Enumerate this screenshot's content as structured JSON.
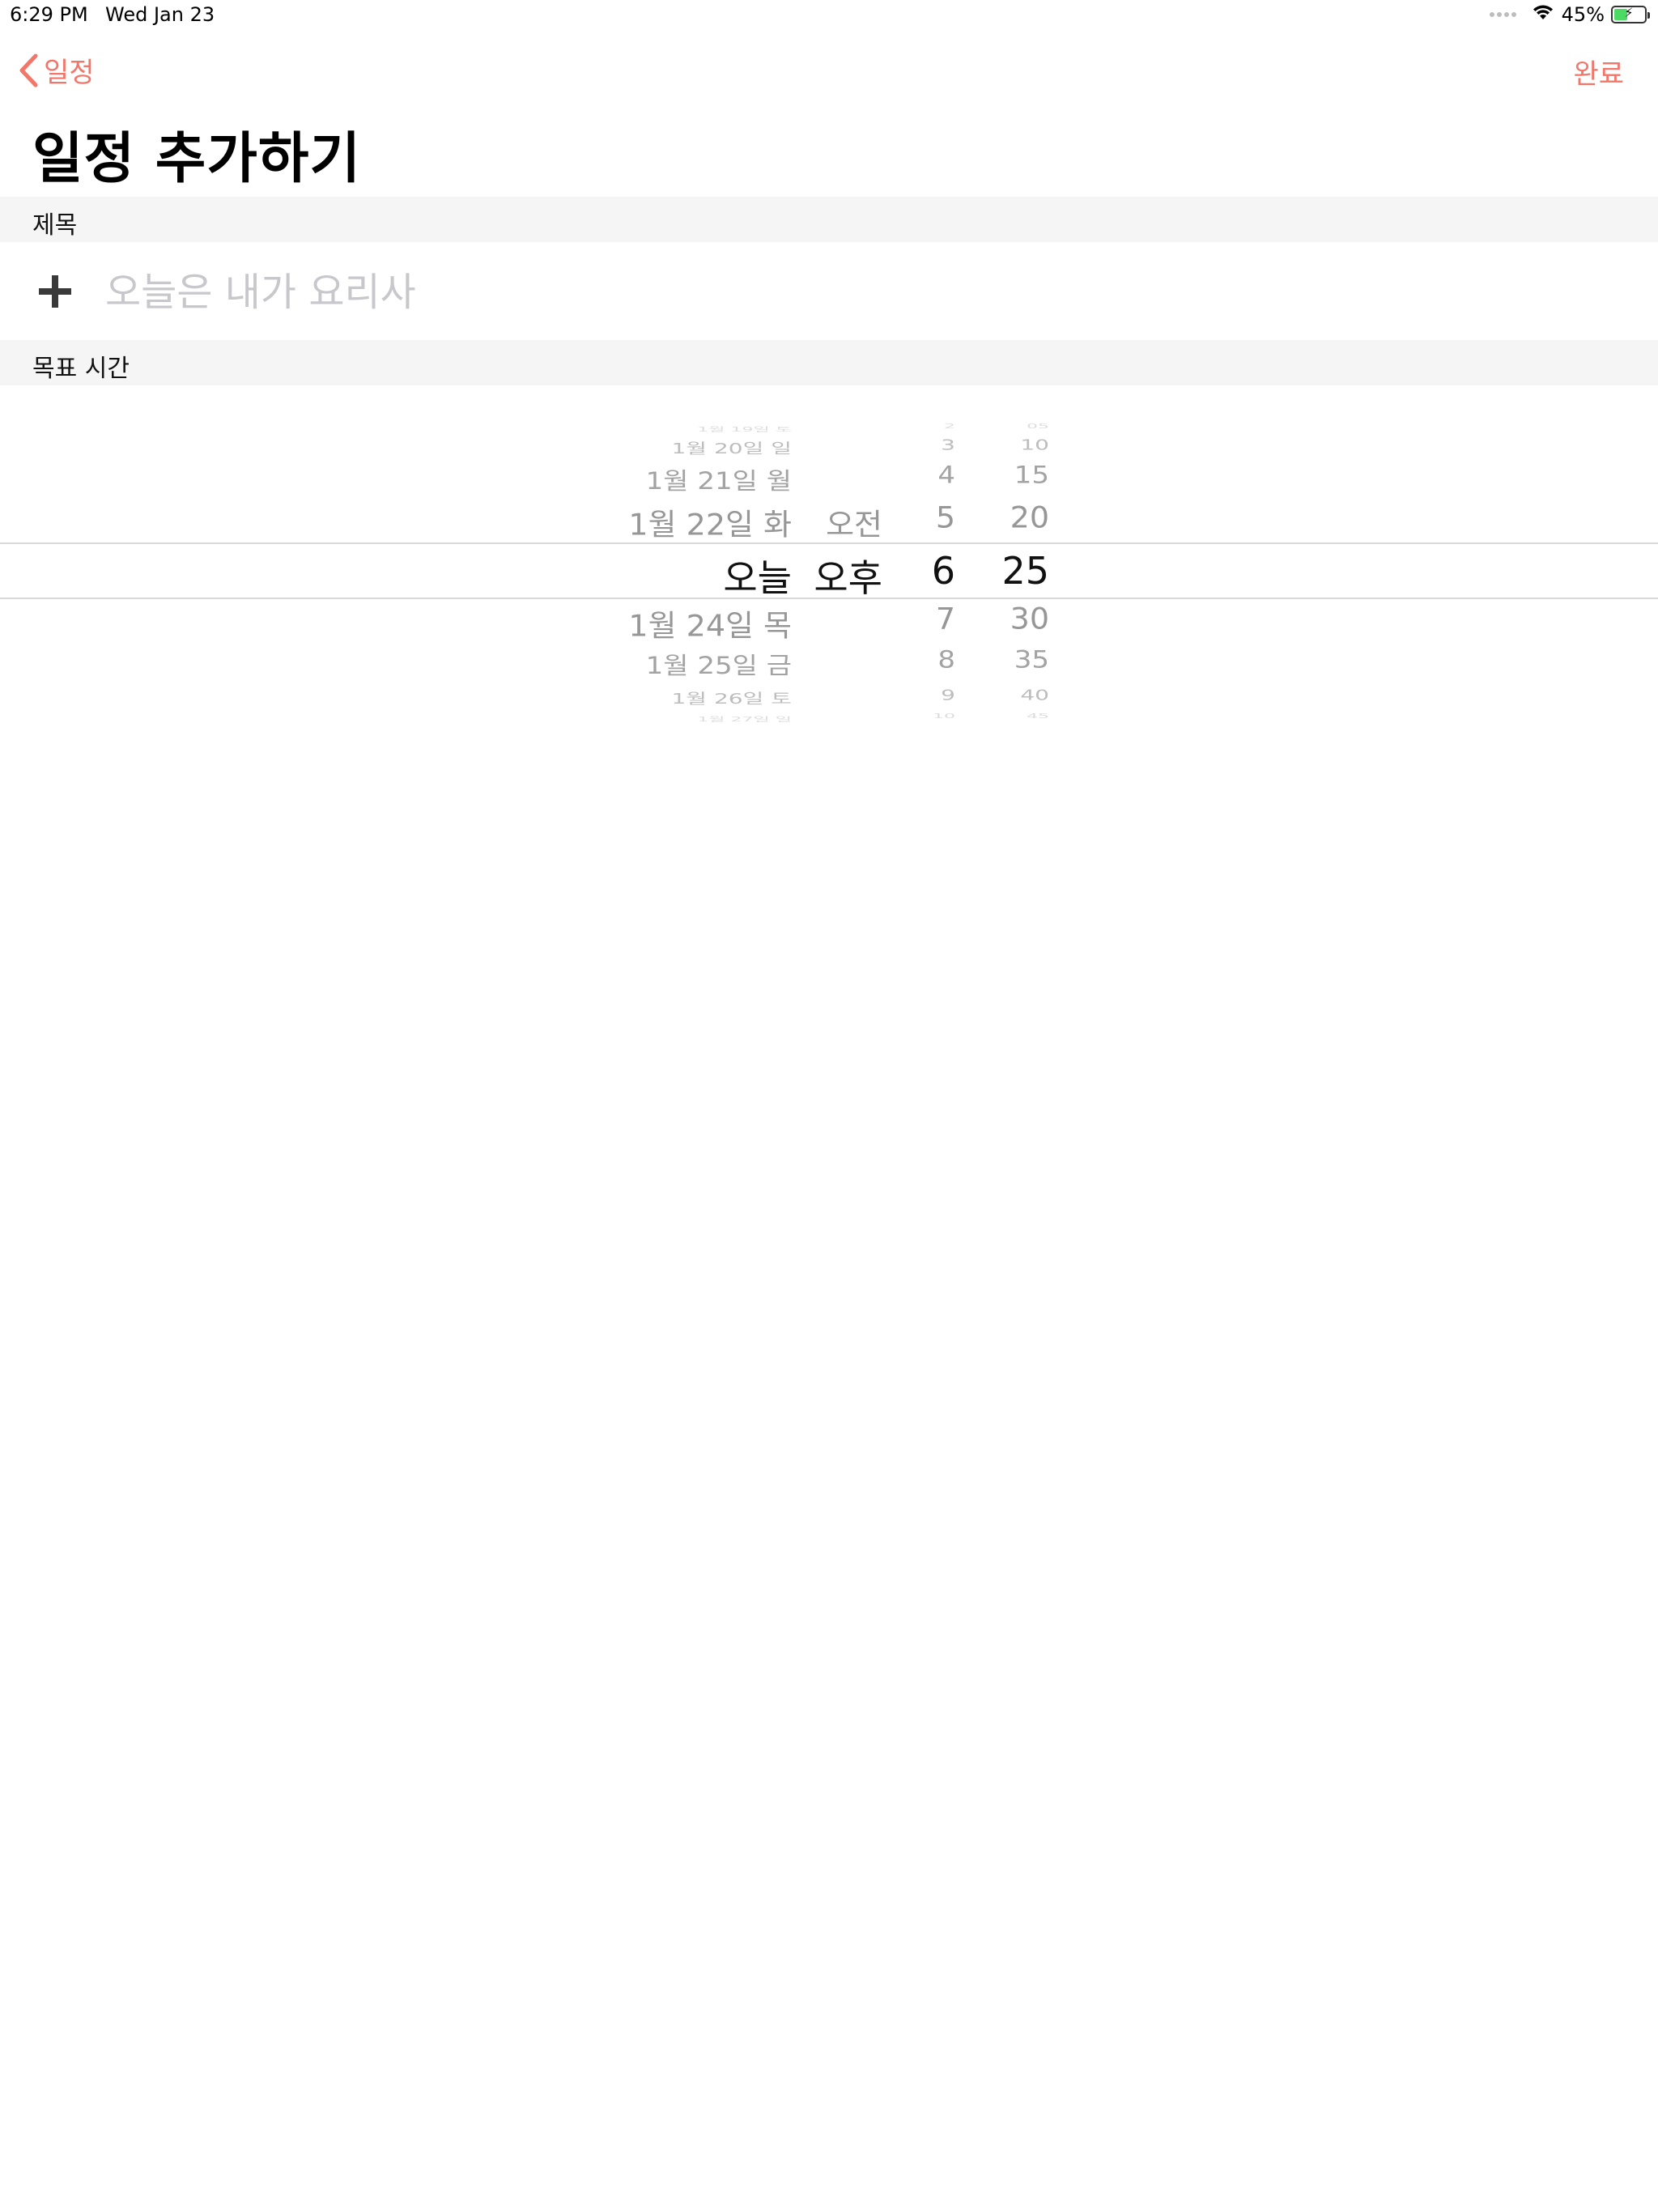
{
  "status_bar": {
    "time": "6:29 PM",
    "date": "Wed Jan 23",
    "battery_percent": "45%",
    "battery_level": 0.45,
    "icons": [
      "cellular-dots-icon",
      "wifi-icon",
      "battery-charging-icon"
    ]
  },
  "nav": {
    "back_label": "일정",
    "done_label": "완료",
    "accent_color": "#f2776b"
  },
  "page": {
    "title": "일정 추가하기"
  },
  "sections": {
    "title_header": "제목",
    "time_header": "목표 시간"
  },
  "title_field": {
    "value": "",
    "placeholder": "오늘은 내가 요리사"
  },
  "picker": {
    "dates": [
      "1월 19일 토",
      "1월 20일 일",
      "1월 21일 월",
      "1월 22일 화",
      "오늘",
      "1월 24일 목",
      "1월 25일 금",
      "1월 26일 토",
      "1월 27일 일"
    ],
    "ampm": [
      "",
      "",
      "",
      "오전",
      "오후",
      "",
      "",
      "",
      ""
    ],
    "hours": [
      "2",
      "3",
      "4",
      "5",
      "6",
      "7",
      "8",
      "9",
      "10"
    ],
    "minutes": [
      "05",
      "10",
      "15",
      "20",
      "25",
      "30",
      "35",
      "40",
      "45"
    ],
    "selected": {
      "date": "오늘",
      "ampm": "오후",
      "hour": "6",
      "minute": "25"
    }
  }
}
